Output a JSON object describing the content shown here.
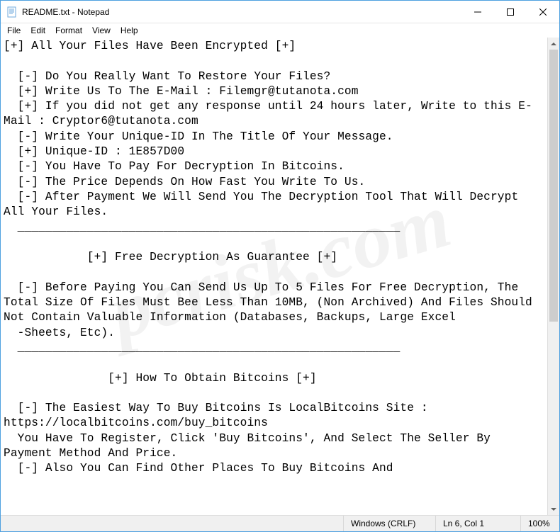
{
  "titlebar": {
    "title": "README.txt - Notepad"
  },
  "menu": {
    "file": "File",
    "edit": "Edit",
    "format": "Format",
    "view": "View",
    "help": "Help"
  },
  "content": {
    "text": "[+] All Your Files Have Been Encrypted [+]\n\n  [-] Do You Really Want To Restore Your Files?\n  [+] Write Us To The E-Mail : Filemgr@tutanota.com\n  [+] If you did not get any response until 24 hours later, Write to this E-Mail : Cryptor6@tutanota.com\n  [-] Write Your Unique-ID In The Title Of Your Message.\n  [+] Unique-ID : 1E857D00\n  [-] You Have To Pay For Decryption In Bitcoins.\n  [-] The Price Depends On How Fast You Write To Us.\n  [-] After Payment We Will Send You The Decryption Tool That Will Decrypt All Your Files.\n  _______________________________________________________\n\n            [+] Free Decryption As Guarantee [+]\n\n  [-] Before Paying You Can Send Us Up To 5 Files For Free Decryption, The Total Size Of Files Must Bee Less Than 10MB, (Non Archived) And Files Should Not Contain Valuable Information (Databases, Backups, Large Excel\n  -Sheets, Etc).\n  _______________________________________________________\n\n               [+] How To Obtain Bitcoins [+]\n\n  [-] The Easiest Way To Buy Bitcoins Is LocalBitcoins Site : https://localbitcoins.com/buy_bitcoins\n  You Have To Register, Click 'Buy Bitcoins', And Select The Seller By Payment Method And Price.\n  [-] Also You Can Find Other Places To Buy Bitcoins And"
  },
  "statusbar": {
    "encoding": "Windows (CRLF)",
    "position": "Ln 6, Col 1",
    "zoom": "100%"
  },
  "watermark": "pcrisk.com"
}
